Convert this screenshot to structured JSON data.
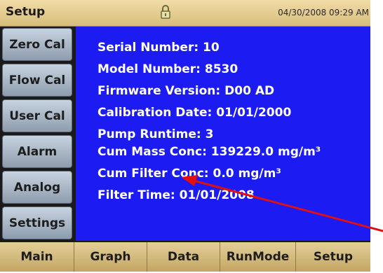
{
  "header": {
    "title": "Setup",
    "datetime": "04/30/2008 09:29 AM",
    "lock_icon": "padlock-icon"
  },
  "sidebar": {
    "items": [
      {
        "label": "Zero Cal"
      },
      {
        "label": "Flow Cal"
      },
      {
        "label": "User Cal"
      },
      {
        "label": "Alarm"
      },
      {
        "label": "Analog"
      },
      {
        "label": "Settings"
      }
    ]
  },
  "info": {
    "serial_number": "Serial Number:  10",
    "model_number": "Model Number:  8530",
    "firmware_version": "Firmware Version:  D00   AD",
    "calibration_date": "Calibration Date:  01/01/2000",
    "pump_runtime": "Pump Runtime:  3",
    "cum_mass_conc": "Cum Mass Conc:  139229.0 mg/m³",
    "cum_filter_conc": "Cum Filter Conc:  0.0 mg/m³",
    "filter_time": "Filter Time:  01/01/2008"
  },
  "bottom_nav": {
    "items": [
      {
        "label": "Main"
      },
      {
        "label": "Graph"
      },
      {
        "label": "Data"
      },
      {
        "label": "RunMode"
      },
      {
        "label": "Setup"
      }
    ]
  },
  "colors": {
    "panel_background": "#1b1bf2",
    "annotation_arrow": "#e01010",
    "bar_gold": "#d7bd7c"
  }
}
